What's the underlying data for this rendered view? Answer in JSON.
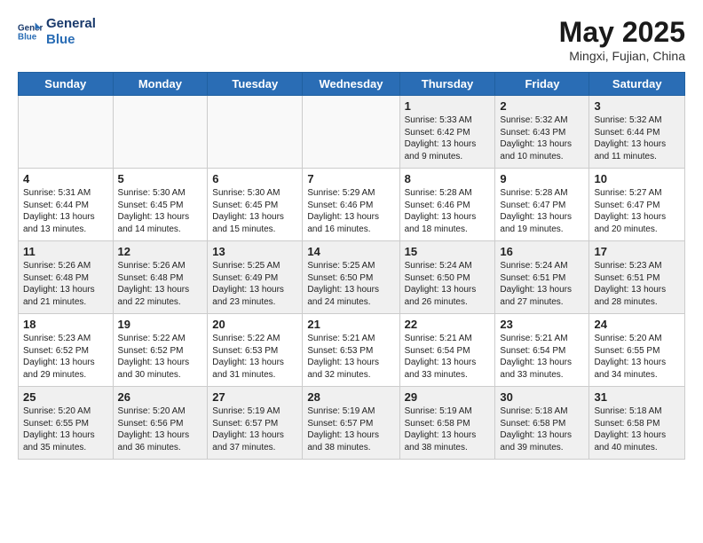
{
  "header": {
    "logo_line1": "General",
    "logo_line2": "Blue",
    "month": "May 2025",
    "location": "Mingxi, Fujian, China"
  },
  "days_of_week": [
    "Sunday",
    "Monday",
    "Tuesday",
    "Wednesday",
    "Thursday",
    "Friday",
    "Saturday"
  ],
  "weeks": [
    [
      {
        "day": "",
        "info": ""
      },
      {
        "day": "",
        "info": ""
      },
      {
        "day": "",
        "info": ""
      },
      {
        "day": "",
        "info": ""
      },
      {
        "day": "1",
        "info": "Sunrise: 5:33 AM\nSunset: 6:42 PM\nDaylight: 13 hours\nand 9 minutes."
      },
      {
        "day": "2",
        "info": "Sunrise: 5:32 AM\nSunset: 6:43 PM\nDaylight: 13 hours\nand 10 minutes."
      },
      {
        "day": "3",
        "info": "Sunrise: 5:32 AM\nSunset: 6:44 PM\nDaylight: 13 hours\nand 11 minutes."
      }
    ],
    [
      {
        "day": "4",
        "info": "Sunrise: 5:31 AM\nSunset: 6:44 PM\nDaylight: 13 hours\nand 13 minutes."
      },
      {
        "day": "5",
        "info": "Sunrise: 5:30 AM\nSunset: 6:45 PM\nDaylight: 13 hours\nand 14 minutes."
      },
      {
        "day": "6",
        "info": "Sunrise: 5:30 AM\nSunset: 6:45 PM\nDaylight: 13 hours\nand 15 minutes."
      },
      {
        "day": "7",
        "info": "Sunrise: 5:29 AM\nSunset: 6:46 PM\nDaylight: 13 hours\nand 16 minutes."
      },
      {
        "day": "8",
        "info": "Sunrise: 5:28 AM\nSunset: 6:46 PM\nDaylight: 13 hours\nand 18 minutes."
      },
      {
        "day": "9",
        "info": "Sunrise: 5:28 AM\nSunset: 6:47 PM\nDaylight: 13 hours\nand 19 minutes."
      },
      {
        "day": "10",
        "info": "Sunrise: 5:27 AM\nSunset: 6:47 PM\nDaylight: 13 hours\nand 20 minutes."
      }
    ],
    [
      {
        "day": "11",
        "info": "Sunrise: 5:26 AM\nSunset: 6:48 PM\nDaylight: 13 hours\nand 21 minutes."
      },
      {
        "day": "12",
        "info": "Sunrise: 5:26 AM\nSunset: 6:48 PM\nDaylight: 13 hours\nand 22 minutes."
      },
      {
        "day": "13",
        "info": "Sunrise: 5:25 AM\nSunset: 6:49 PM\nDaylight: 13 hours\nand 23 minutes."
      },
      {
        "day": "14",
        "info": "Sunrise: 5:25 AM\nSunset: 6:50 PM\nDaylight: 13 hours\nand 24 minutes."
      },
      {
        "day": "15",
        "info": "Sunrise: 5:24 AM\nSunset: 6:50 PM\nDaylight: 13 hours\nand 26 minutes."
      },
      {
        "day": "16",
        "info": "Sunrise: 5:24 AM\nSunset: 6:51 PM\nDaylight: 13 hours\nand 27 minutes."
      },
      {
        "day": "17",
        "info": "Sunrise: 5:23 AM\nSunset: 6:51 PM\nDaylight: 13 hours\nand 28 minutes."
      }
    ],
    [
      {
        "day": "18",
        "info": "Sunrise: 5:23 AM\nSunset: 6:52 PM\nDaylight: 13 hours\nand 29 minutes."
      },
      {
        "day": "19",
        "info": "Sunrise: 5:22 AM\nSunset: 6:52 PM\nDaylight: 13 hours\nand 30 minutes."
      },
      {
        "day": "20",
        "info": "Sunrise: 5:22 AM\nSunset: 6:53 PM\nDaylight: 13 hours\nand 31 minutes."
      },
      {
        "day": "21",
        "info": "Sunrise: 5:21 AM\nSunset: 6:53 PM\nDaylight: 13 hours\nand 32 minutes."
      },
      {
        "day": "22",
        "info": "Sunrise: 5:21 AM\nSunset: 6:54 PM\nDaylight: 13 hours\nand 33 minutes."
      },
      {
        "day": "23",
        "info": "Sunrise: 5:21 AM\nSunset: 6:54 PM\nDaylight: 13 hours\nand 33 minutes."
      },
      {
        "day": "24",
        "info": "Sunrise: 5:20 AM\nSunset: 6:55 PM\nDaylight: 13 hours\nand 34 minutes."
      }
    ],
    [
      {
        "day": "25",
        "info": "Sunrise: 5:20 AM\nSunset: 6:55 PM\nDaylight: 13 hours\nand 35 minutes."
      },
      {
        "day": "26",
        "info": "Sunrise: 5:20 AM\nSunset: 6:56 PM\nDaylight: 13 hours\nand 36 minutes."
      },
      {
        "day": "27",
        "info": "Sunrise: 5:19 AM\nSunset: 6:57 PM\nDaylight: 13 hours\nand 37 minutes."
      },
      {
        "day": "28",
        "info": "Sunrise: 5:19 AM\nSunset: 6:57 PM\nDaylight: 13 hours\nand 38 minutes."
      },
      {
        "day": "29",
        "info": "Sunrise: 5:19 AM\nSunset: 6:58 PM\nDaylight: 13 hours\nand 38 minutes."
      },
      {
        "day": "30",
        "info": "Sunrise: 5:18 AM\nSunset: 6:58 PM\nDaylight: 13 hours\nand 39 minutes."
      },
      {
        "day": "31",
        "info": "Sunrise: 5:18 AM\nSunset: 6:58 PM\nDaylight: 13 hours\nand 40 minutes."
      }
    ]
  ]
}
